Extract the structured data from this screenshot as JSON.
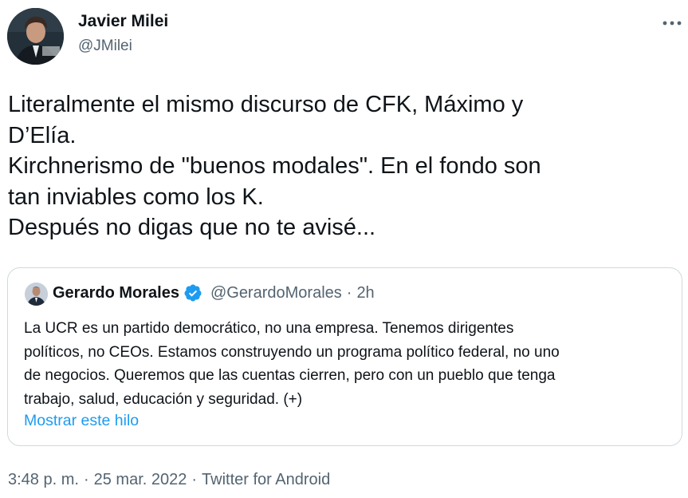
{
  "author": {
    "name": "Javier Milei",
    "handle": "@JMilei",
    "avatar_icon": "profile-photo"
  },
  "more_icon": "more-options-icon",
  "tweet": {
    "lines": [
      "Literalmente el mismo discurso de CFK, Máximo y",
      "D’Elía.",
      "Kirchnerismo de \"buenos modales\". En el fondo son",
      "tan inviables como los K.",
      "Después no digas que no te avisé..."
    ]
  },
  "quote": {
    "name": "Gerardo Morales",
    "verified_icon": "verified-badge-icon",
    "handle": "@GerardoMorales",
    "separator": "·",
    "time": "2h",
    "text_lines": [
      "La UCR es un partido democrático, no una empresa. Tenemos dirigentes",
      "políticos, no CEOs. Estamos construyendo un programa político federal, no uno",
      "de negocios. Queremos que las cuentas cierren, pero con un pueblo que tenga",
      "trabajo, salud, educación y seguridad. (+)"
    ],
    "show_thread": "Mostrar este hilo"
  },
  "meta": {
    "time": "3:48 p. m.",
    "date": "25 mar. 2022",
    "source": "Twitter for Android",
    "separator": "·"
  },
  "colors": {
    "text": "#0f1419",
    "secondary": "#536471",
    "link": "#1d9bf0",
    "border": "#cfd9de"
  }
}
